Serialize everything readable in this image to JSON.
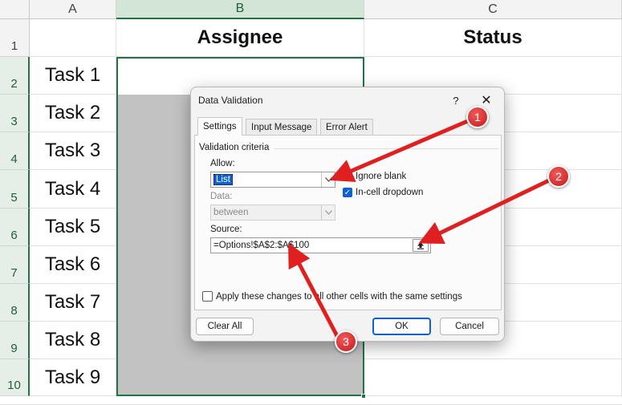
{
  "sheet": {
    "columns": [
      "A",
      "B",
      "C"
    ],
    "rows": [
      "1",
      "2",
      "3",
      "4",
      "5",
      "6",
      "7",
      "8",
      "9",
      "10"
    ],
    "headers": {
      "b": "Assignee",
      "c": "Status"
    },
    "tasks": [
      "Task 1",
      "Task 2",
      "Task 3",
      "Task 4",
      "Task 5",
      "Task 6",
      "Task 7",
      "Task 8",
      "Task 9"
    ]
  },
  "dialog": {
    "title": "Data Validation",
    "help": "?",
    "close": "✕",
    "tabs": [
      "Settings",
      "Input Message",
      "Error Alert"
    ],
    "criteria_label": "Validation criteria",
    "allow_label": "Allow:",
    "allow_value": "List",
    "data_label": "Data:",
    "data_value": "between",
    "ignore_blank": "Ignore blank",
    "in_cell_dropdown": "In-cell dropdown",
    "source_label": "Source:",
    "source_value": "=Options!$A$2:$A$100",
    "apply_all": "Apply these changes to all other cells with the same settings",
    "clear_all": "Clear All",
    "ok": "OK",
    "cancel": "Cancel"
  },
  "annotations": [
    "1",
    "2",
    "3"
  ],
  "colors": {
    "accent_green": "#217346",
    "annotation_red": "#e02020",
    "selection_blue": "#0e60d8"
  }
}
